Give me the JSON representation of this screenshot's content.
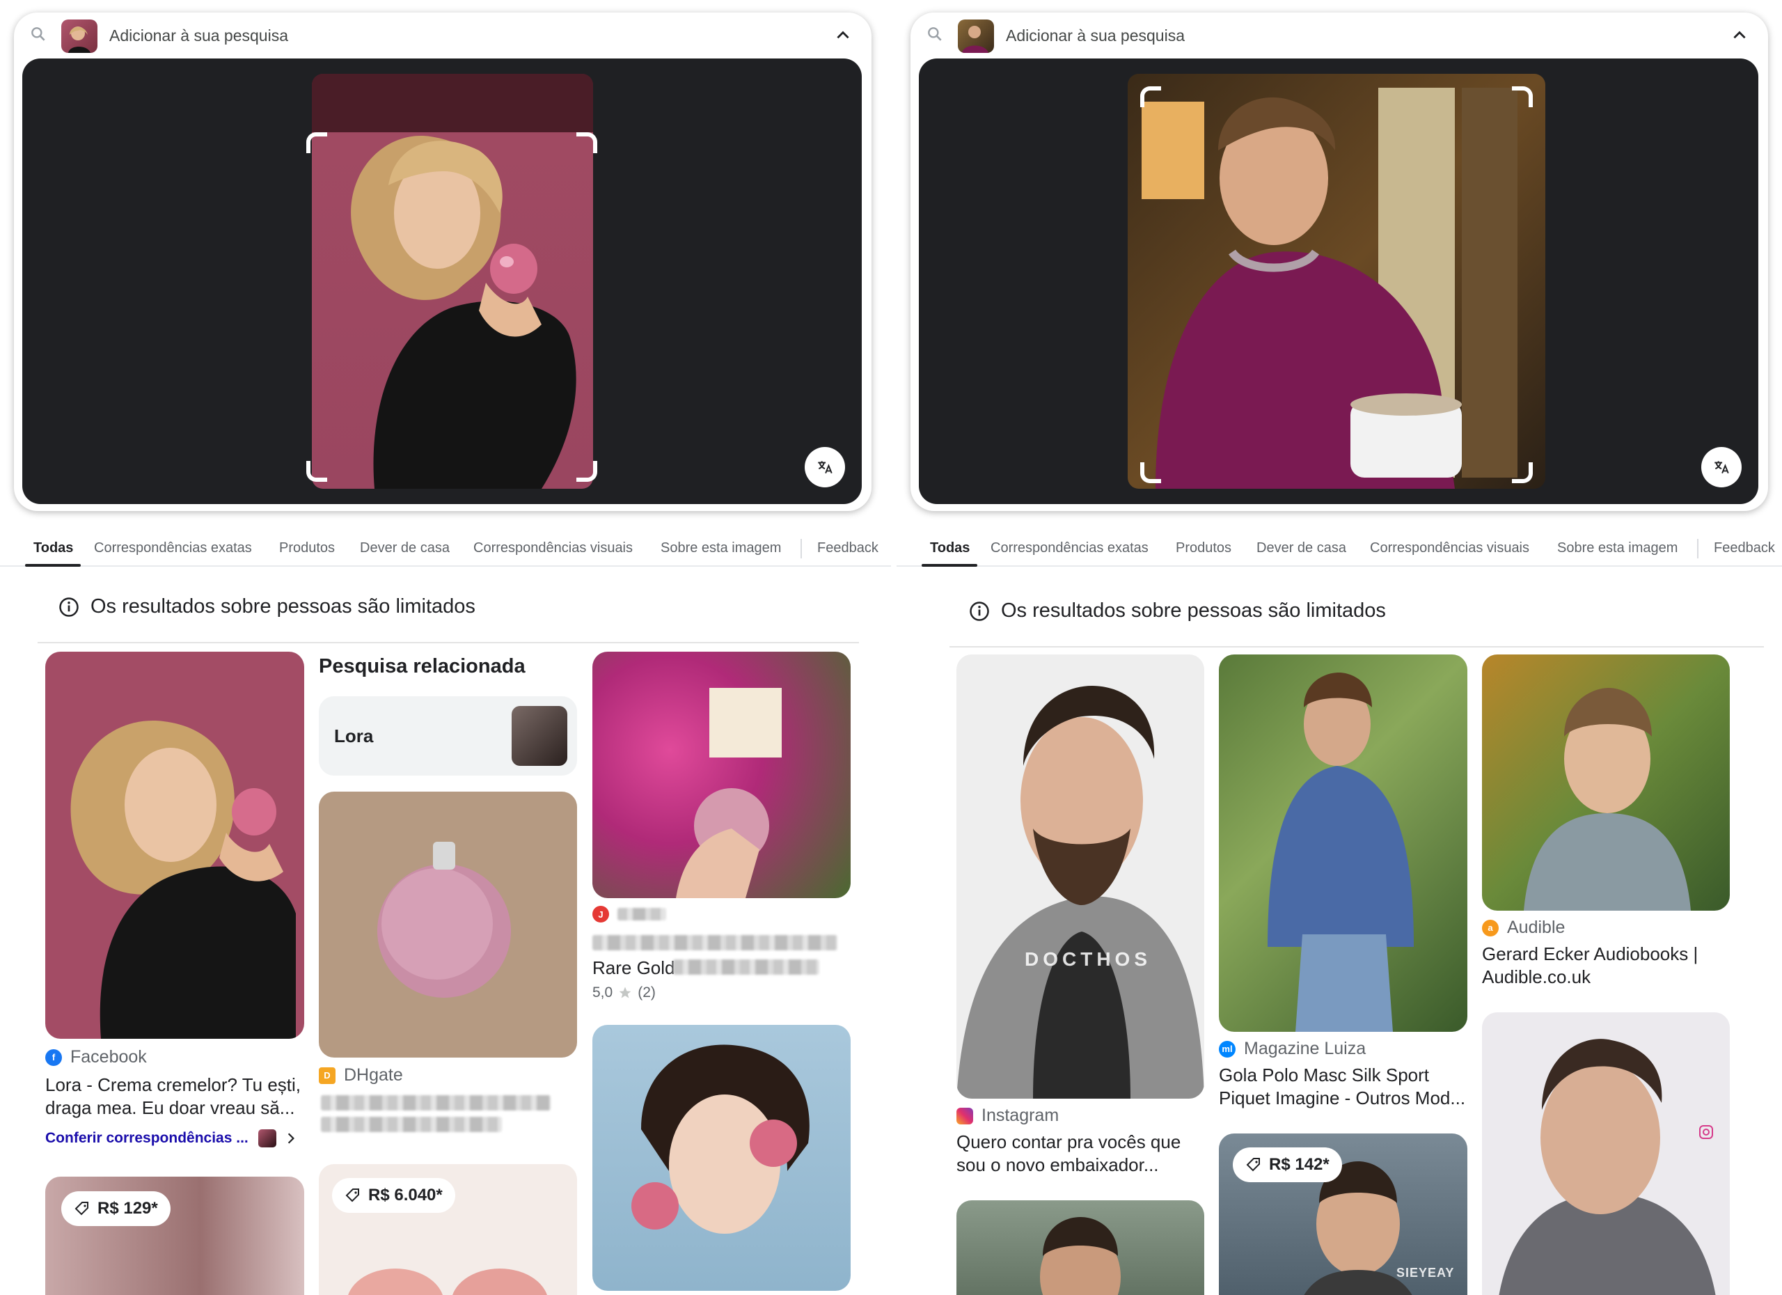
{
  "left": {
    "search_label": "Adicionar à sua pesquisa",
    "tabs": [
      "Todas",
      "Correspondências exatas",
      "Produtos",
      "Dever de casa",
      "Correspondências visuais",
      "Sobre esta imagem",
      "Feedback"
    ],
    "notice": "Os resultados sobre pessoas são limitados",
    "result1": {
      "source": "Facebook",
      "title": "Lora - Crema cremelor? Tu ești, draga mea. Eu doar vreau să...",
      "link": "Conferir correspondências ..."
    },
    "related": {
      "heading": "Pesquisa relacionada",
      "chip": "Lora"
    },
    "result2": {
      "source": "DHgate"
    },
    "result3": {
      "title": "Rare Gold",
      "rating": "5,0",
      "count": "(2)"
    },
    "price1": "R$ 129*",
    "price2": "R$ 6.040*"
  },
  "right": {
    "search_label": "Adicionar à sua pesquisa",
    "tabs": [
      "Todas",
      "Correspondências exatas",
      "Produtos",
      "Dever de casa",
      "Correspondências visuais",
      "Sobre esta imagem",
      "Feedback"
    ],
    "notice": "Os resultados sobre pessoas são limitados",
    "result1": {
      "source": "Instagram",
      "title": "Quero contar pra vocês que sou o novo embaixador..."
    },
    "result2": {
      "source": "Magazine Luiza",
      "title": "Gola Polo Masc Silk Sport Piquet Imagine - Outros Mod..."
    },
    "result3": {
      "source": "Audible",
      "title": "Gerard Ecker Audiobooks | Audible.co.uk"
    },
    "watermark1": "DOCTHOS",
    "watermark2": "SIEYEAY",
    "price1": "R$ 142*"
  },
  "colors": {
    "accent": "#1a0dab",
    "viewer_bg": "#1f2023",
    "pink_bg": "#a85068",
    "shirt": "#7a1a52"
  },
  "icons": [
    "search-icon",
    "chevron-up-icon",
    "translate-icon",
    "info-icon",
    "tag-icon",
    "star-icon",
    "chevron-right-icon"
  ]
}
